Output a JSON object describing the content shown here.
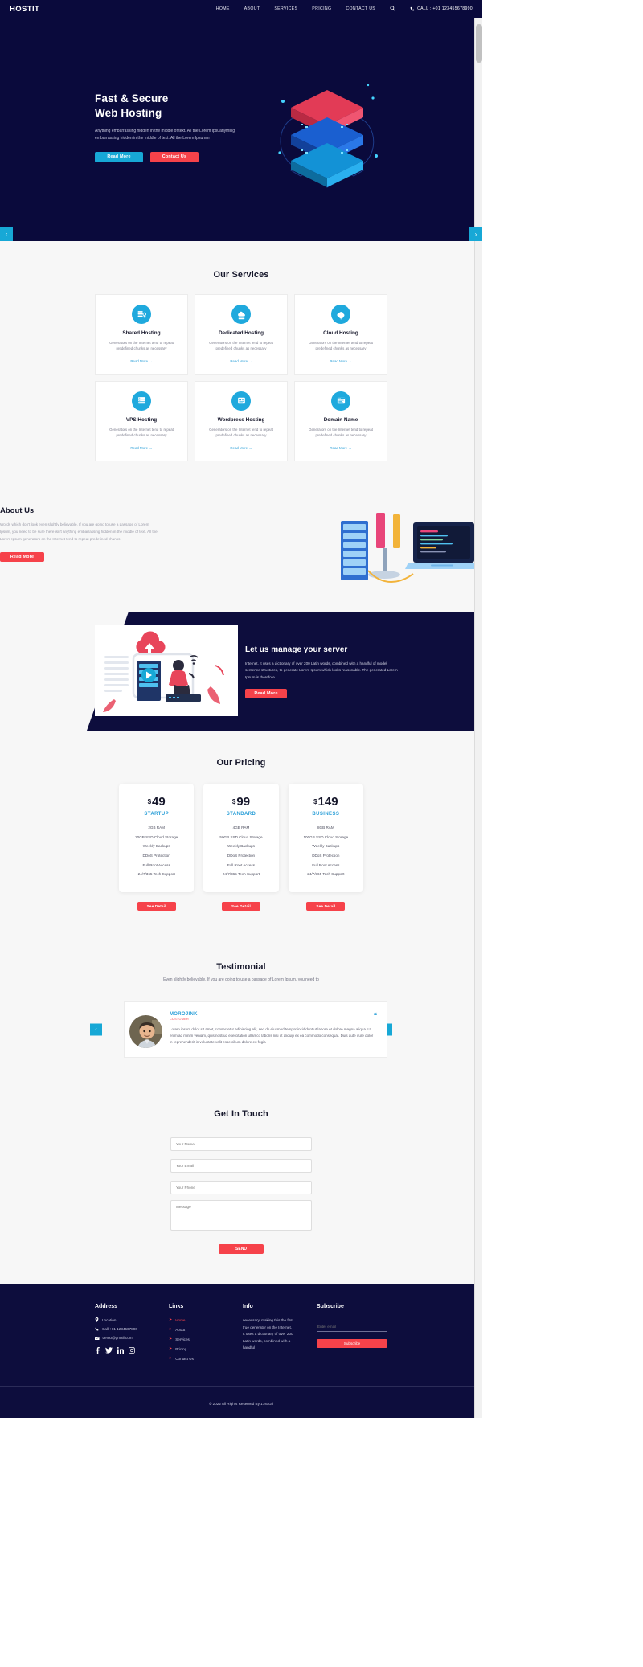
{
  "header": {
    "logo": "HOSTIT",
    "nav": [
      {
        "label": "HOME"
      },
      {
        "label": "ABOUT"
      },
      {
        "label": "SERVICES"
      },
      {
        "label": "PRICING"
      },
      {
        "label": "CONTACT US"
      }
    ],
    "search_icon": "search-icon",
    "phone_icon": "phone-icon",
    "call_label": "CALL : +01 123455678990"
  },
  "hero": {
    "title_line1": "Fast & Secure",
    "title_line2": "Web Hosting",
    "paragraph": "Anything embarrassing hidden in the middle of text. All the Lorem Ipsuanything embarrassing hidden in the middle of text. All the Lorem Ipsumm",
    "btn_primary": "Read More",
    "btn_secondary": "Contact Us",
    "prev_arrow": "‹",
    "next_arrow": "›"
  },
  "services": {
    "title": "Our Services",
    "cards": [
      {
        "icon": "shared-hosting-icon",
        "title": "Shared Hosting",
        "desc": "Generators on the Internet tend to repeat predefined chunks as necessary",
        "link": "Read More →"
      },
      {
        "icon": "dedicated-hosting-icon",
        "title": "Dedicated Hosting",
        "desc": "Generators on the Internet tend to repeat predefined chunks as necessary",
        "link": "Read More →"
      },
      {
        "icon": "cloud-hosting-icon",
        "title": "Cloud Hosting",
        "desc": "Generators on the Internet tend to repeat predefined chunks as necessary",
        "link": "Read More →"
      },
      {
        "icon": "vps-hosting-icon",
        "title": "VPS Hosting",
        "desc": "Generators on the Internet tend to repeat predefined chunks as necessary",
        "link": "Read More →"
      },
      {
        "icon": "wordpress-hosting-icon",
        "title": "Wordpress Hosting",
        "desc": "Generators on the Internet tend to repeat predefined chunks as necessary",
        "link": "Read More →"
      },
      {
        "icon": "domain-name-icon",
        "title": "Domain Name",
        "desc": "Generators on the Internet tend to repeat predefined chunks as necessary",
        "link": "Read More →"
      }
    ]
  },
  "about": {
    "title": "About Us",
    "paragraph": "Words which don't look even slightly believable. If you are going to use a passage of Lorem Ipsum, you need to be sure there isn't anything embarrassing hidden in the middle of text. All the Lorem Ipsum generators on the Internet tend to repeat predefined chunks",
    "button": "Read More"
  },
  "manage": {
    "title": "Let us manage your server",
    "paragraph": "Internet. It uses a dictionary of over 200 Latin words, combined with a handful of model sentence structures, to generate Lorem Ipsum which looks reasonable. The generated Lorem Ipsum is therefore",
    "button": "Read More"
  },
  "pricing": {
    "title": "Our Pricing",
    "plans": [
      {
        "currency": "$",
        "amount": "49",
        "name": "STARTUP",
        "features": [
          "2GB RAM",
          "20GB SSD Cloud Storage",
          "Weekly Backups",
          "DDoS Protection",
          "Full Root Access",
          "24/7/365 Tech Support"
        ],
        "button": "See Detail"
      },
      {
        "currency": "$",
        "amount": "99",
        "name": "STANDARD",
        "features": [
          "4GB RAM",
          "50GB SSD Cloud Storage",
          "Weekly Backups",
          "DDoS Protection",
          "Full Root Access",
          "24/7/365 Tech Support"
        ],
        "button": "See Detail"
      },
      {
        "currency": "$",
        "amount": "149",
        "name": "BUSINESS",
        "features": [
          "8GB RAM",
          "100GB SSD Cloud Storage",
          "Weekly Backups",
          "DDoS Protection",
          "Full Root Access",
          "24/7/365 Tech Support"
        ],
        "button": "See Detail"
      }
    ]
  },
  "testimonial": {
    "title": "Testimonial",
    "subtitle": "Even slightly believable. If you are going to use a passage of Lorem Ipsum, you need to",
    "name": "MOROJINK",
    "role": "CUSTOMER",
    "quote_icon": "quote-icon",
    "text": "Lorem ipsum dolor sit amet, consectetur adipiscing elit, sed do eiusmod tempor incididunt ut labore et dolore magna aliqua. Ut enim ad minim veniam, quis nostrud exercitation ullamco laboris nisi ut aliquip ex ea commodo consequat. Duis aute irure dolor in reprehenderit in voluptate velit esse cillum dolore eu fugia",
    "prev_arrow": "‹",
    "next_arrow": "›"
  },
  "contact": {
    "title": "Get In Touch",
    "name_placeholder": "Your Name",
    "email_placeholder": "Your Email",
    "phone_placeholder": "Your Phone",
    "message_placeholder": "Message",
    "send_label": "SEND"
  },
  "footer": {
    "address": {
      "heading": "Address",
      "location": "Location",
      "phone": "Call +01 1234567890",
      "email": "demo@gmail.com",
      "socials": [
        "facebook-icon",
        "twitter-icon",
        "linkedin-icon",
        "instagram-icon"
      ]
    },
    "links": {
      "heading": "Links",
      "items": [
        {
          "label": "Home",
          "active": true
        },
        {
          "label": "About",
          "active": false
        },
        {
          "label": "Services",
          "active": false
        },
        {
          "label": "Pricing",
          "active": false
        },
        {
          "label": "Contact Us",
          "active": false
        }
      ]
    },
    "info": {
      "heading": "Info",
      "text": "necessary, making this the first true generator on the Internet. It uses a dictionary of over 200 Latin words, combined with a handful"
    },
    "subscribe": {
      "heading": "Subscribe",
      "placeholder": "Enter email",
      "button": "Subscribe"
    },
    "copyright": "© 2022 All Rights Reserved By 17sucai"
  },
  "colors": {
    "navy": "#0a0a3c",
    "dark_navy": "#0d0d3d",
    "blue": "#17a8d6",
    "red": "#f6424a",
    "bg": "#f7f7f7"
  }
}
